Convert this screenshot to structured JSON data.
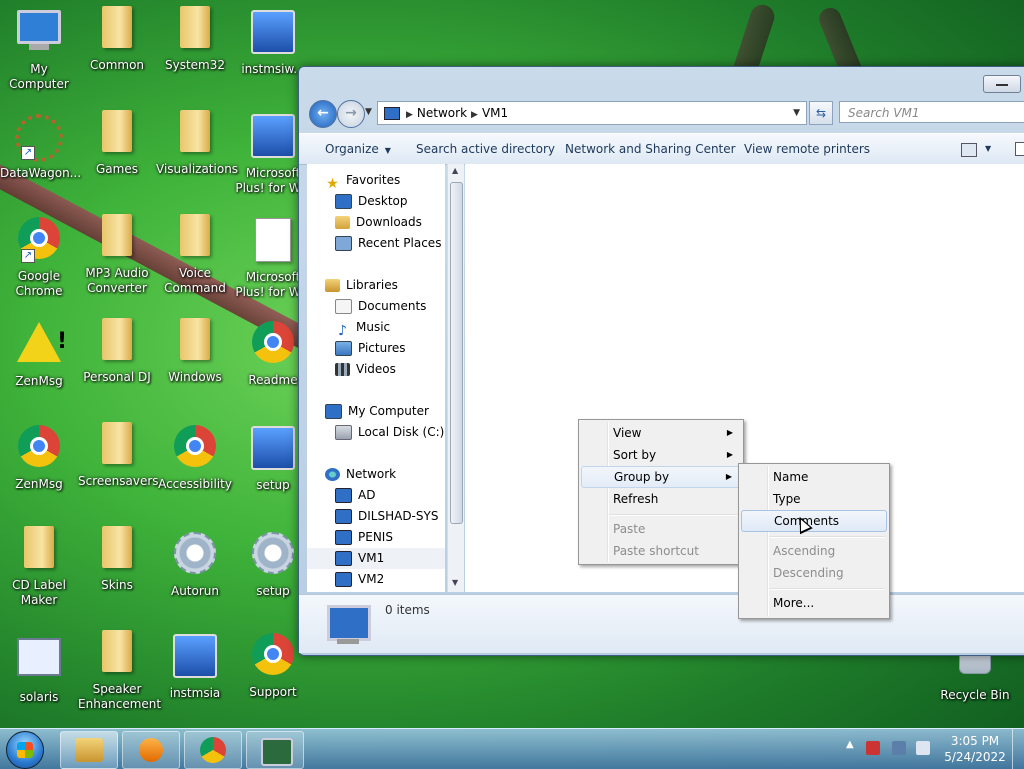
{
  "desktop": {
    "icons": [
      {
        "label": "My Computer"
      },
      {
        "label": "Common"
      },
      {
        "label": "System32"
      },
      {
        "label": "instmsiw..."
      },
      {
        "label": "DataWagon..."
      },
      {
        "label": "Games"
      },
      {
        "label": "Visualizations"
      },
      {
        "label": "Microsoft Plus! for W..."
      },
      {
        "label": "Google Chrome"
      },
      {
        "label": "MP3 Audio Converter"
      },
      {
        "label": "Voice Command"
      },
      {
        "label": "Microsoft Plus! for W..."
      },
      {
        "label": "ZenMsg"
      },
      {
        "label": "Personal DJ"
      },
      {
        "label": "Windows"
      },
      {
        "label": "Readme"
      },
      {
        "label": "ZenMsg"
      },
      {
        "label": "Screensavers"
      },
      {
        "label": "Accessibility"
      },
      {
        "label": "setup"
      },
      {
        "label": "CD Label Maker"
      },
      {
        "label": "Skins"
      },
      {
        "label": "Autorun"
      },
      {
        "label": "setup"
      },
      {
        "label": "solaris"
      },
      {
        "label": "Speaker Enhancement"
      },
      {
        "label": "instmsia"
      },
      {
        "label": "Support"
      },
      {
        "label": "Recycle Bin"
      }
    ]
  },
  "explorer": {
    "breadcrumb": [
      "Network",
      "VM1"
    ],
    "search_placeholder": "Search VM1",
    "toolbar": {
      "organize": "Organize",
      "search_ad": "Search active directory",
      "network_center": "Network and Sharing Center",
      "remote_printers": "View remote printers"
    },
    "nav": {
      "favorites": {
        "label": "Favorites",
        "items": [
          "Desktop",
          "Downloads",
          "Recent Places"
        ]
      },
      "libraries": {
        "label": "Libraries",
        "items": [
          "Documents",
          "Music",
          "Pictures",
          "Videos"
        ]
      },
      "computer": {
        "label": "My Computer",
        "items": [
          "Local Disk (C:)"
        ]
      },
      "network": {
        "label": "Network",
        "items": [
          "AD",
          "DILSHAD-SYS",
          "PENIS",
          "VM1",
          "VM2"
        ],
        "selected": "VM1"
      }
    },
    "details": {
      "items_count": "0 items"
    }
  },
  "context_menu": {
    "items": [
      "View",
      "Sort by",
      "Group by",
      "Refresh",
      "Paste",
      "Paste shortcut"
    ]
  },
  "group_by_menu": {
    "items": [
      "Name",
      "Type",
      "Comments",
      "Ascending",
      "Descending",
      "More..."
    ],
    "highlighted": "Comments"
  },
  "taskbar": {
    "clock_time": "3:05 PM",
    "clock_date": "5/24/2022"
  }
}
